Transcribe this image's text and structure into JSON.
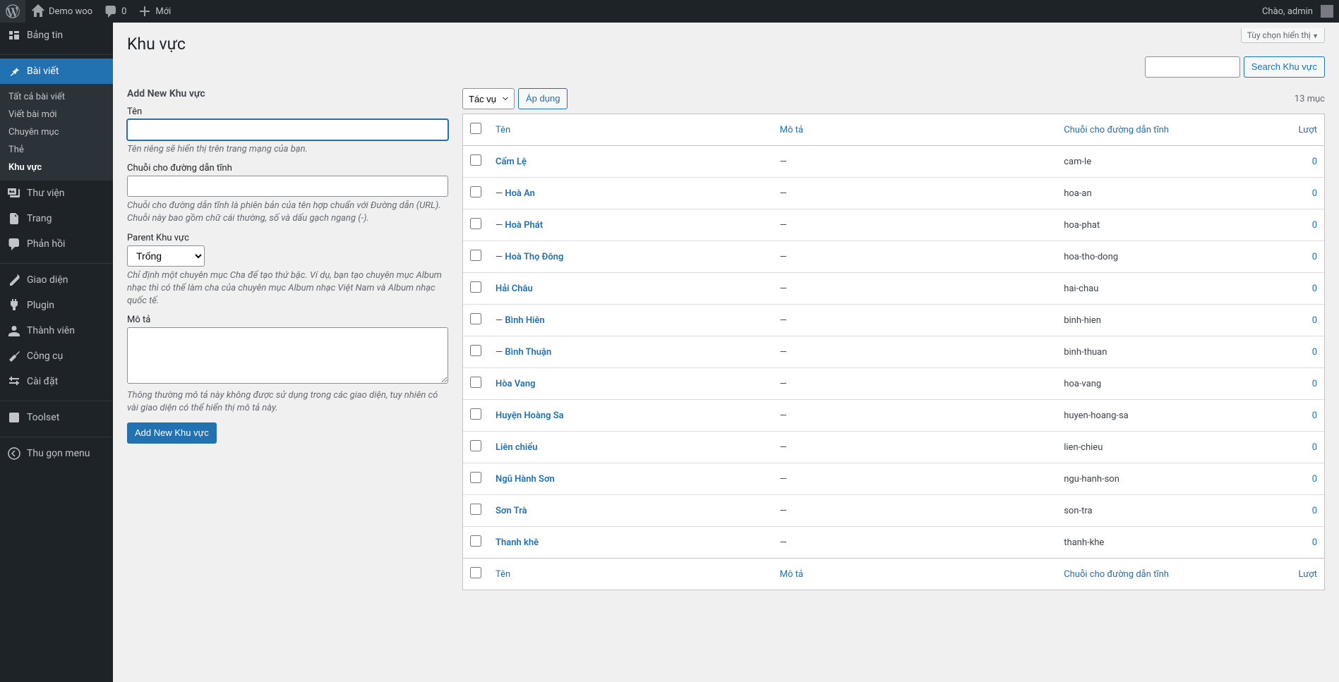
{
  "adminbar": {
    "site_name": "Demo woo",
    "comments": "0",
    "new": "Mới",
    "greeting": "Chào, admin"
  },
  "sidebar": {
    "dashboard": "Bảng tin",
    "posts": "Bài viết",
    "media": "Thư viện",
    "pages": "Trang",
    "comments": "Phản hồi",
    "appearance": "Giao diện",
    "plugins": "Plugin",
    "users": "Thành viên",
    "tools": "Công cụ",
    "settings": "Cài đặt",
    "toolset": "Toolset",
    "collapse": "Thu gọn menu",
    "submenu": {
      "all": "Tất cả bài viết",
      "new": "Viết bài mới",
      "cat": "Chuyên mục",
      "tag": "Thẻ",
      "area": "Khu vực"
    }
  },
  "page": {
    "title": "Khu vực",
    "screen_options": "Tùy chọn hiển thị",
    "search_button": "Search Khu vực"
  },
  "form": {
    "heading": "Add New Khu vực",
    "name_label": "Tên",
    "name_hint": "Tên riêng sẽ hiển thị trên trang mạng của bạn.",
    "slug_label": "Chuỗi cho đường dẫn tĩnh",
    "slug_hint": "Chuỗi cho đường dẫn tĩnh là phiên bản của tên hợp chuẩn với Đường dẫn (URL). Chuỗi này bao gồm chữ cái thường, số và dấu gạch ngang (-).",
    "parent_label": "Parent Khu vực",
    "parent_option": "Trống",
    "parent_hint": "Chỉ định một chuyên mục Cha để tạo thứ bậc. Ví dụ, bạn tạo chuyên mục Album nhạc thì có thể làm cha của chuyên mục Album nhạc Việt Nam và Album nhạc quốc tế.",
    "desc_label": "Mô tả",
    "desc_hint": "Thông thường mô tả này không được sử dụng trong các giao diện, tuy nhiên có vài giao diện có thể hiển thị mô tả này.",
    "submit": "Add New Khu vực"
  },
  "bulk": {
    "action_label": "Tác vụ",
    "apply": "Áp dụng",
    "count": "13 mục"
  },
  "columns": {
    "name": "Tên",
    "desc": "Mô tả",
    "slug": "Chuỗi cho đường dẫn tĩnh",
    "count": "Lượt"
  },
  "rows": [
    {
      "name": "Cẩm Lệ",
      "indent": "",
      "desc": "—",
      "slug": "cam-le",
      "count": "0"
    },
    {
      "name": "Hoà An",
      "indent": "— ",
      "desc": "—",
      "slug": "hoa-an",
      "count": "0"
    },
    {
      "name": "Hoà Phát",
      "indent": "— ",
      "desc": "—",
      "slug": "hoa-phat",
      "count": "0"
    },
    {
      "name": "Hoà Thọ Đông",
      "indent": "— ",
      "desc": "—",
      "slug": "hoa-tho-dong",
      "count": "0"
    },
    {
      "name": "Hải Châu",
      "indent": "",
      "desc": "—",
      "slug": "hai-chau",
      "count": "0"
    },
    {
      "name": "Bình Hiên",
      "indent": "— ",
      "desc": "—",
      "slug": "binh-hien",
      "count": "0"
    },
    {
      "name": "Bình Thuận",
      "indent": "— ",
      "desc": "—",
      "slug": "binh-thuan",
      "count": "0"
    },
    {
      "name": "Hòa Vang",
      "indent": "",
      "desc": "—",
      "slug": "hoa-vang",
      "count": "0"
    },
    {
      "name": "Huyện Hoàng Sa",
      "indent": "",
      "desc": "—",
      "slug": "huyen-hoang-sa",
      "count": "0"
    },
    {
      "name": "Liên chiểu",
      "indent": "",
      "desc": "—",
      "slug": "lien-chieu",
      "count": "0"
    },
    {
      "name": "Ngũ Hành Sơn",
      "indent": "",
      "desc": "—",
      "slug": "ngu-hanh-son",
      "count": "0"
    },
    {
      "name": "Sơn Trà",
      "indent": "",
      "desc": "—",
      "slug": "son-tra",
      "count": "0"
    },
    {
      "name": "Thanh khê",
      "indent": "",
      "desc": "—",
      "slug": "thanh-khe",
      "count": "0"
    }
  ]
}
